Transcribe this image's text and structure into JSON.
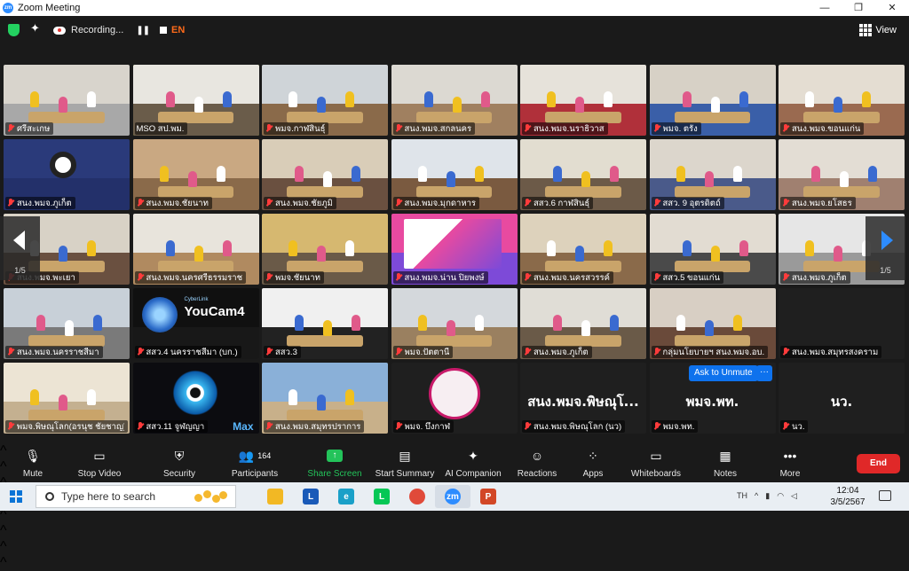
{
  "window": {
    "title": "Zoom Meeting",
    "logo": "zm"
  },
  "topbar": {
    "recording_label": "Recording...",
    "language": "EN",
    "view_label": "View"
  },
  "colors": {
    "accent": "#2d8cff",
    "active_speaker": "#c9ea3a",
    "end": "#e02828",
    "share": "#23c35a",
    "muted_mic": "#ff3b3b"
  },
  "gallery": {
    "page_left": "1/5",
    "page_right": "1/5",
    "tiles": [
      {
        "name": "ศรีสะเกษ",
        "wall": "#d8d4cc",
        "floor": "#a8a8a8"
      },
      {
        "name": "MSO สป.พม.",
        "wall": "#e8e6e0",
        "floor": "#6a5c4a",
        "active": true
      },
      {
        "name": "พมจ.กาฬสินธุ์",
        "wall": "#cfd4d8",
        "floor": "#8a6a4a"
      },
      {
        "name": "สนง.พมจ.สกลนคร",
        "wall": "#dcd9d2",
        "floor": "#a08060"
      },
      {
        "name": "สนง.พมจ.นราธิวาส",
        "wall": "#e6e2da",
        "floor": "#b0303a"
      },
      {
        "name": "พมจ. ตรัง",
        "wall": "#d7d1c6",
        "floor": "#3a5fa8"
      },
      {
        "name": "สนง.พมจ.ขอนแก่น",
        "wall": "#e4ddd2",
        "floor": "#9a6a50"
      },
      {
        "name": "สนง.พมจ.ภูเก็ต",
        "wall": "#2a3a7a",
        "floor": "#23306a",
        "obs": true
      },
      {
        "name": "สนง.พมจ.ชัยนาท",
        "wall": "#c9a882",
        "floor": "#8a6a4a"
      },
      {
        "name": "สนง.พมจ.ชัยภูมิ",
        "wall": "#d9cdb8",
        "floor": "#6a5040"
      },
      {
        "name": "สนง.พมจ.มุกดาหาร",
        "wall": "#dfe4ea",
        "floor": "#7a5a40"
      },
      {
        "name": "สสว.6 กาฬสินธุ์",
        "wall": "#e2ddd0",
        "floor": "#6c5a48"
      },
      {
        "name": "สสว. 9 อุตรดิตถ์",
        "wall": "#dcd6cc",
        "floor": "#4a5a8a"
      },
      {
        "name": "สนง.พมจ.ยโสธร",
        "wall": "#e3ddd4",
        "floor": "#a08070"
      },
      {
        "name": "สนง.พมจ.พะเยา",
        "wall": "#d8d2c6",
        "floor": "#6a5040"
      },
      {
        "name": "สนง.พมจ.นครศรีธรรมราช",
        "wall": "#e8e4dc",
        "floor": "#b08a60"
      },
      {
        "name": "พมจ.ชัยนาท",
        "wall": "#d6b870",
        "floor": "#6a5a48"
      },
      {
        "name": "สนง.พมจ.น่าน ปิยพงษ์",
        "wall": "#e84aa0",
        "floor": "#7d4ad8",
        "slide": true
      },
      {
        "name": "สนง.พมจ.นครสวรรค์",
        "wall": "#ddd2bc",
        "floor": "#8a6a4a"
      },
      {
        "name": "สสว.5 ขอนแก่น",
        "wall": "#e2dcd2",
        "floor": "#4a4a4a"
      },
      {
        "name": "สนง.พมจ.ภูเก็ต",
        "wall": "#e6e6e6",
        "floor": "#9a9a9a"
      },
      {
        "name": "สนง.พมจ.นครราชสีมา",
        "wall": "#c8d0d8",
        "floor": "#7a7a7a"
      },
      {
        "name": "สสว.4 นครราชสีมา (บก.)",
        "wall": "#101010",
        "floor": "#181818",
        "youcam": true,
        "youcam_title": "YouCam4",
        "youcam_brand": "CyberLink"
      },
      {
        "name": "สสว.3",
        "wall": "#f0f0f0",
        "floor": "#222222"
      },
      {
        "name": "พมจ.ปัตตานี",
        "wall": "#d4d8dc",
        "floor": "#9a8060"
      },
      {
        "name": "สนง.พมจ.ภูเก็ต",
        "wall": "#e0ddd6",
        "floor": "#6a5a48"
      },
      {
        "name": "กลุ่มนโยบายฯ สนง.พมจ.อบ.",
        "wall": "#d8cfc4",
        "floor": "#6a4a3a"
      },
      {
        "name": "สนง.พมจ.สมุทรสงคราม",
        "wall": "#141414",
        "floor": "#141414",
        "blank": true
      },
      {
        "name": "พมจ.พิษณุโลก(อรนุช ชัยชาญ)",
        "wall": "#ece4d4",
        "floor": "#c4b090"
      },
      {
        "name": "สสว.11 จูฬญญา",
        "wall": "#0c0c10",
        "floor": "#0c0c10",
        "eye": true,
        "eye_text": "Max"
      },
      {
        "name": "สนง.พมจ.สมุทรปราการ",
        "wall": "#8ab0d8",
        "floor": "#c8b08a"
      },
      {
        "name": "พมจ. บึงกาฬ",
        "wall": "#1f1f1f",
        "floor": "#1f1f1f",
        "seal": true
      },
      {
        "name": "สนง.พมจ.พิษณุโลก (นว)",
        "wall": "#1f1f1f",
        "floor": "#1f1f1f",
        "text_only": true,
        "big": "สนง.พมจ.พิษณุโ..."
      },
      {
        "name": "พมจ.พท.",
        "wall": "#1f1f1f",
        "floor": "#1f1f1f",
        "text_only": true,
        "big": "พมจ.พท."
      },
      {
        "name": "นว.",
        "wall": "#1f1f1f",
        "floor": "#1f1f1f",
        "text_only": true,
        "big": "นว."
      }
    ],
    "ask_to_unmute": "Ask to Unmute",
    "more_options": "···"
  },
  "controls": {
    "mute": "Mute",
    "stop_video": "Stop Video",
    "security": "Security",
    "participants": "Participants",
    "participant_count": "164",
    "share_screen": "Share Screen",
    "start_summary": "Start Summary",
    "ai_companion": "AI Companion",
    "reactions": "Reactions",
    "apps": "Apps",
    "whiteboards": "Whiteboards",
    "notes": "Notes",
    "more": "More",
    "end": "End"
  },
  "taskbar": {
    "search_placeholder": "Type here to search",
    "apps": [
      {
        "name": "file-explorer",
        "glyph": "",
        "color": "#f2b824"
      },
      {
        "name": "l-app",
        "glyph": "L",
        "color": "#1a5ab8"
      },
      {
        "name": "edge",
        "glyph": "e",
        "color": "#1aa0c8"
      },
      {
        "name": "line",
        "glyph": "L",
        "color": "#06c755"
      },
      {
        "name": "chrome",
        "glyph": "",
        "color": "#e04a3a"
      },
      {
        "name": "zoom",
        "glyph": "zm",
        "color": "#2d8cff"
      },
      {
        "name": "powerpoint",
        "glyph": "P",
        "color": "#d24726"
      }
    ],
    "tray_lang": "TH",
    "time": "12:04",
    "date": "3/5/2567"
  }
}
